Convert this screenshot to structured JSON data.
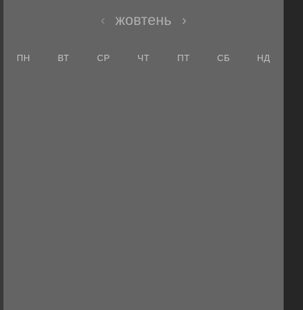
{
  "calendar": {
    "month": "жовтень",
    "prev_icon": "chevron-left-icon",
    "next_icon": "chevron-right-icon",
    "weekdays": [
      "ПН",
      "ВТ",
      "СР",
      "ЧТ",
      "ПТ",
      "СБ",
      "НД"
    ]
  },
  "colors": {
    "panel_background": "#646464",
    "page_background": "#2d2d2d",
    "text": "#c4c4c4"
  }
}
